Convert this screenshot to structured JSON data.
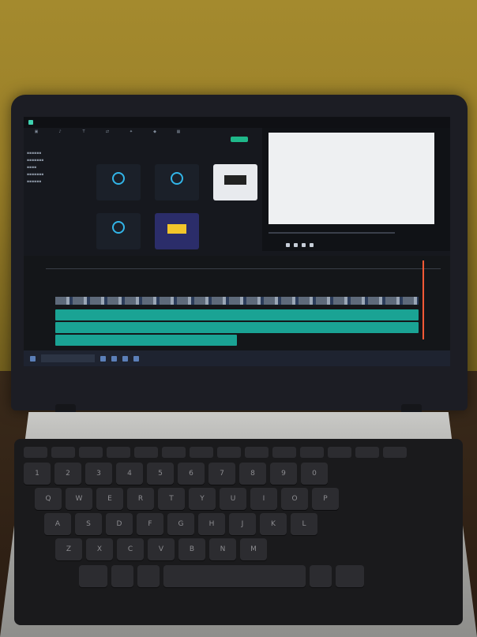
{
  "scene": {
    "description_colors": {
      "wall": "#a48a2e",
      "laptop": "#1c1d24",
      "screen_accent": "#1aa394"
    }
  },
  "app": {
    "icons": [
      "window-icon",
      "user-icon",
      "settings-icon"
    ]
  },
  "keyboard": {
    "row_digits": [
      "1",
      "2",
      "3",
      "4",
      "5",
      "6",
      "7",
      "8",
      "9",
      "0"
    ],
    "row_q": [
      "Q",
      "W",
      "E",
      "R",
      "T",
      "Y",
      "U",
      "I",
      "O",
      "P"
    ],
    "row_a": [
      "A",
      "S",
      "D",
      "F",
      "G",
      "H",
      "J",
      "K",
      "L"
    ],
    "row_z": [
      "Z",
      "X",
      "C",
      "V",
      "B",
      "N",
      "M"
    ]
  }
}
